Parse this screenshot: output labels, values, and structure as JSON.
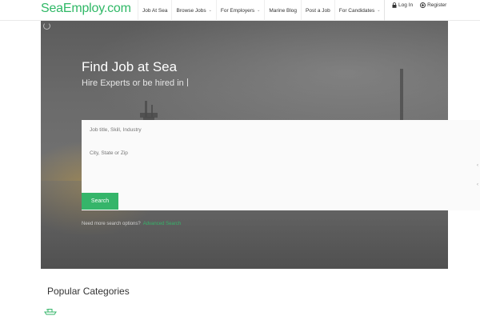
{
  "header": {
    "logo": "SeaEmploy.com",
    "nav": [
      {
        "label": "Job At Sea",
        "chevron": false
      },
      {
        "label": "Browse Jobs",
        "chevron": true
      },
      {
        "label": "For Employers",
        "chevron": true
      },
      {
        "label": "Marine Blog",
        "chevron": false
      },
      {
        "label": "Post a Job",
        "chevron": false
      },
      {
        "label": "For Candidates",
        "chevron": true
      }
    ],
    "login": "Log In",
    "register": "Register"
  },
  "hero": {
    "title": "Find Job at Sea",
    "subtitle": "Hire Experts or be hired in"
  },
  "search": {
    "keyword_placeholder": "Job title, Skill, Industry",
    "location_placeholder": "City, State or Zip",
    "button": "Search",
    "more_text": "Need more search options?",
    "advanced_link": "Advanced Search"
  },
  "popular": {
    "title": "Popular Categories"
  },
  "colors": {
    "brand": "#2fb866",
    "button": "#35b56a"
  },
  "icons": [
    "lock-icon",
    "user-plus-icon",
    "chevron-down-icon",
    "ship-icon",
    "loading-spinner-icon"
  ]
}
